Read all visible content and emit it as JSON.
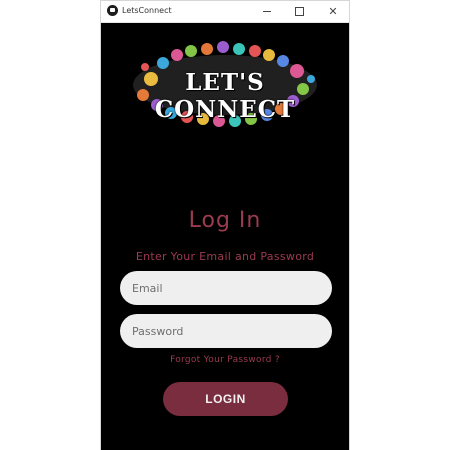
{
  "window": {
    "title": "LetsConnect",
    "controls": {
      "minimize_icon": "minimize-icon",
      "maximize_icon": "maximize-icon",
      "close_icon": "close-icon"
    }
  },
  "logo": {
    "text": "LET'S CONNECT",
    "icon": "colorful-handprints-logo"
  },
  "login": {
    "heading": "Log In",
    "subheading": "Enter Your Email and Password",
    "email_placeholder": "Email",
    "password_placeholder": "Password",
    "forgot_label": "Forgot Your Password ?",
    "button_label": "LOGIN"
  },
  "colors": {
    "background": "#000000",
    "accent": "#9a3b4f",
    "button": "#7a2d3e",
    "field": "#efefef"
  }
}
